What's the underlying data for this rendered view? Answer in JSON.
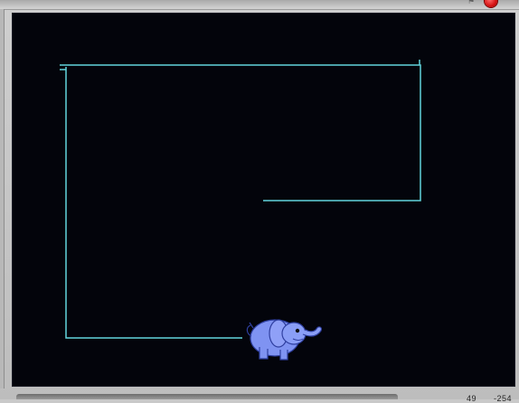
{
  "window": {
    "top_bar": {
      "stop_button_icon": "stop-sign-icon",
      "partial_icon_hint": "green-flag-icon-partial"
    }
  },
  "stage": {
    "background_color": "#03040b",
    "pen_color": "#63d4dc",
    "sprite_name": "elephant-sprite",
    "sprite_color": "#7f93f2"
  },
  "status_bar": {
    "x_coord": "49",
    "y_coord": "-254"
  }
}
